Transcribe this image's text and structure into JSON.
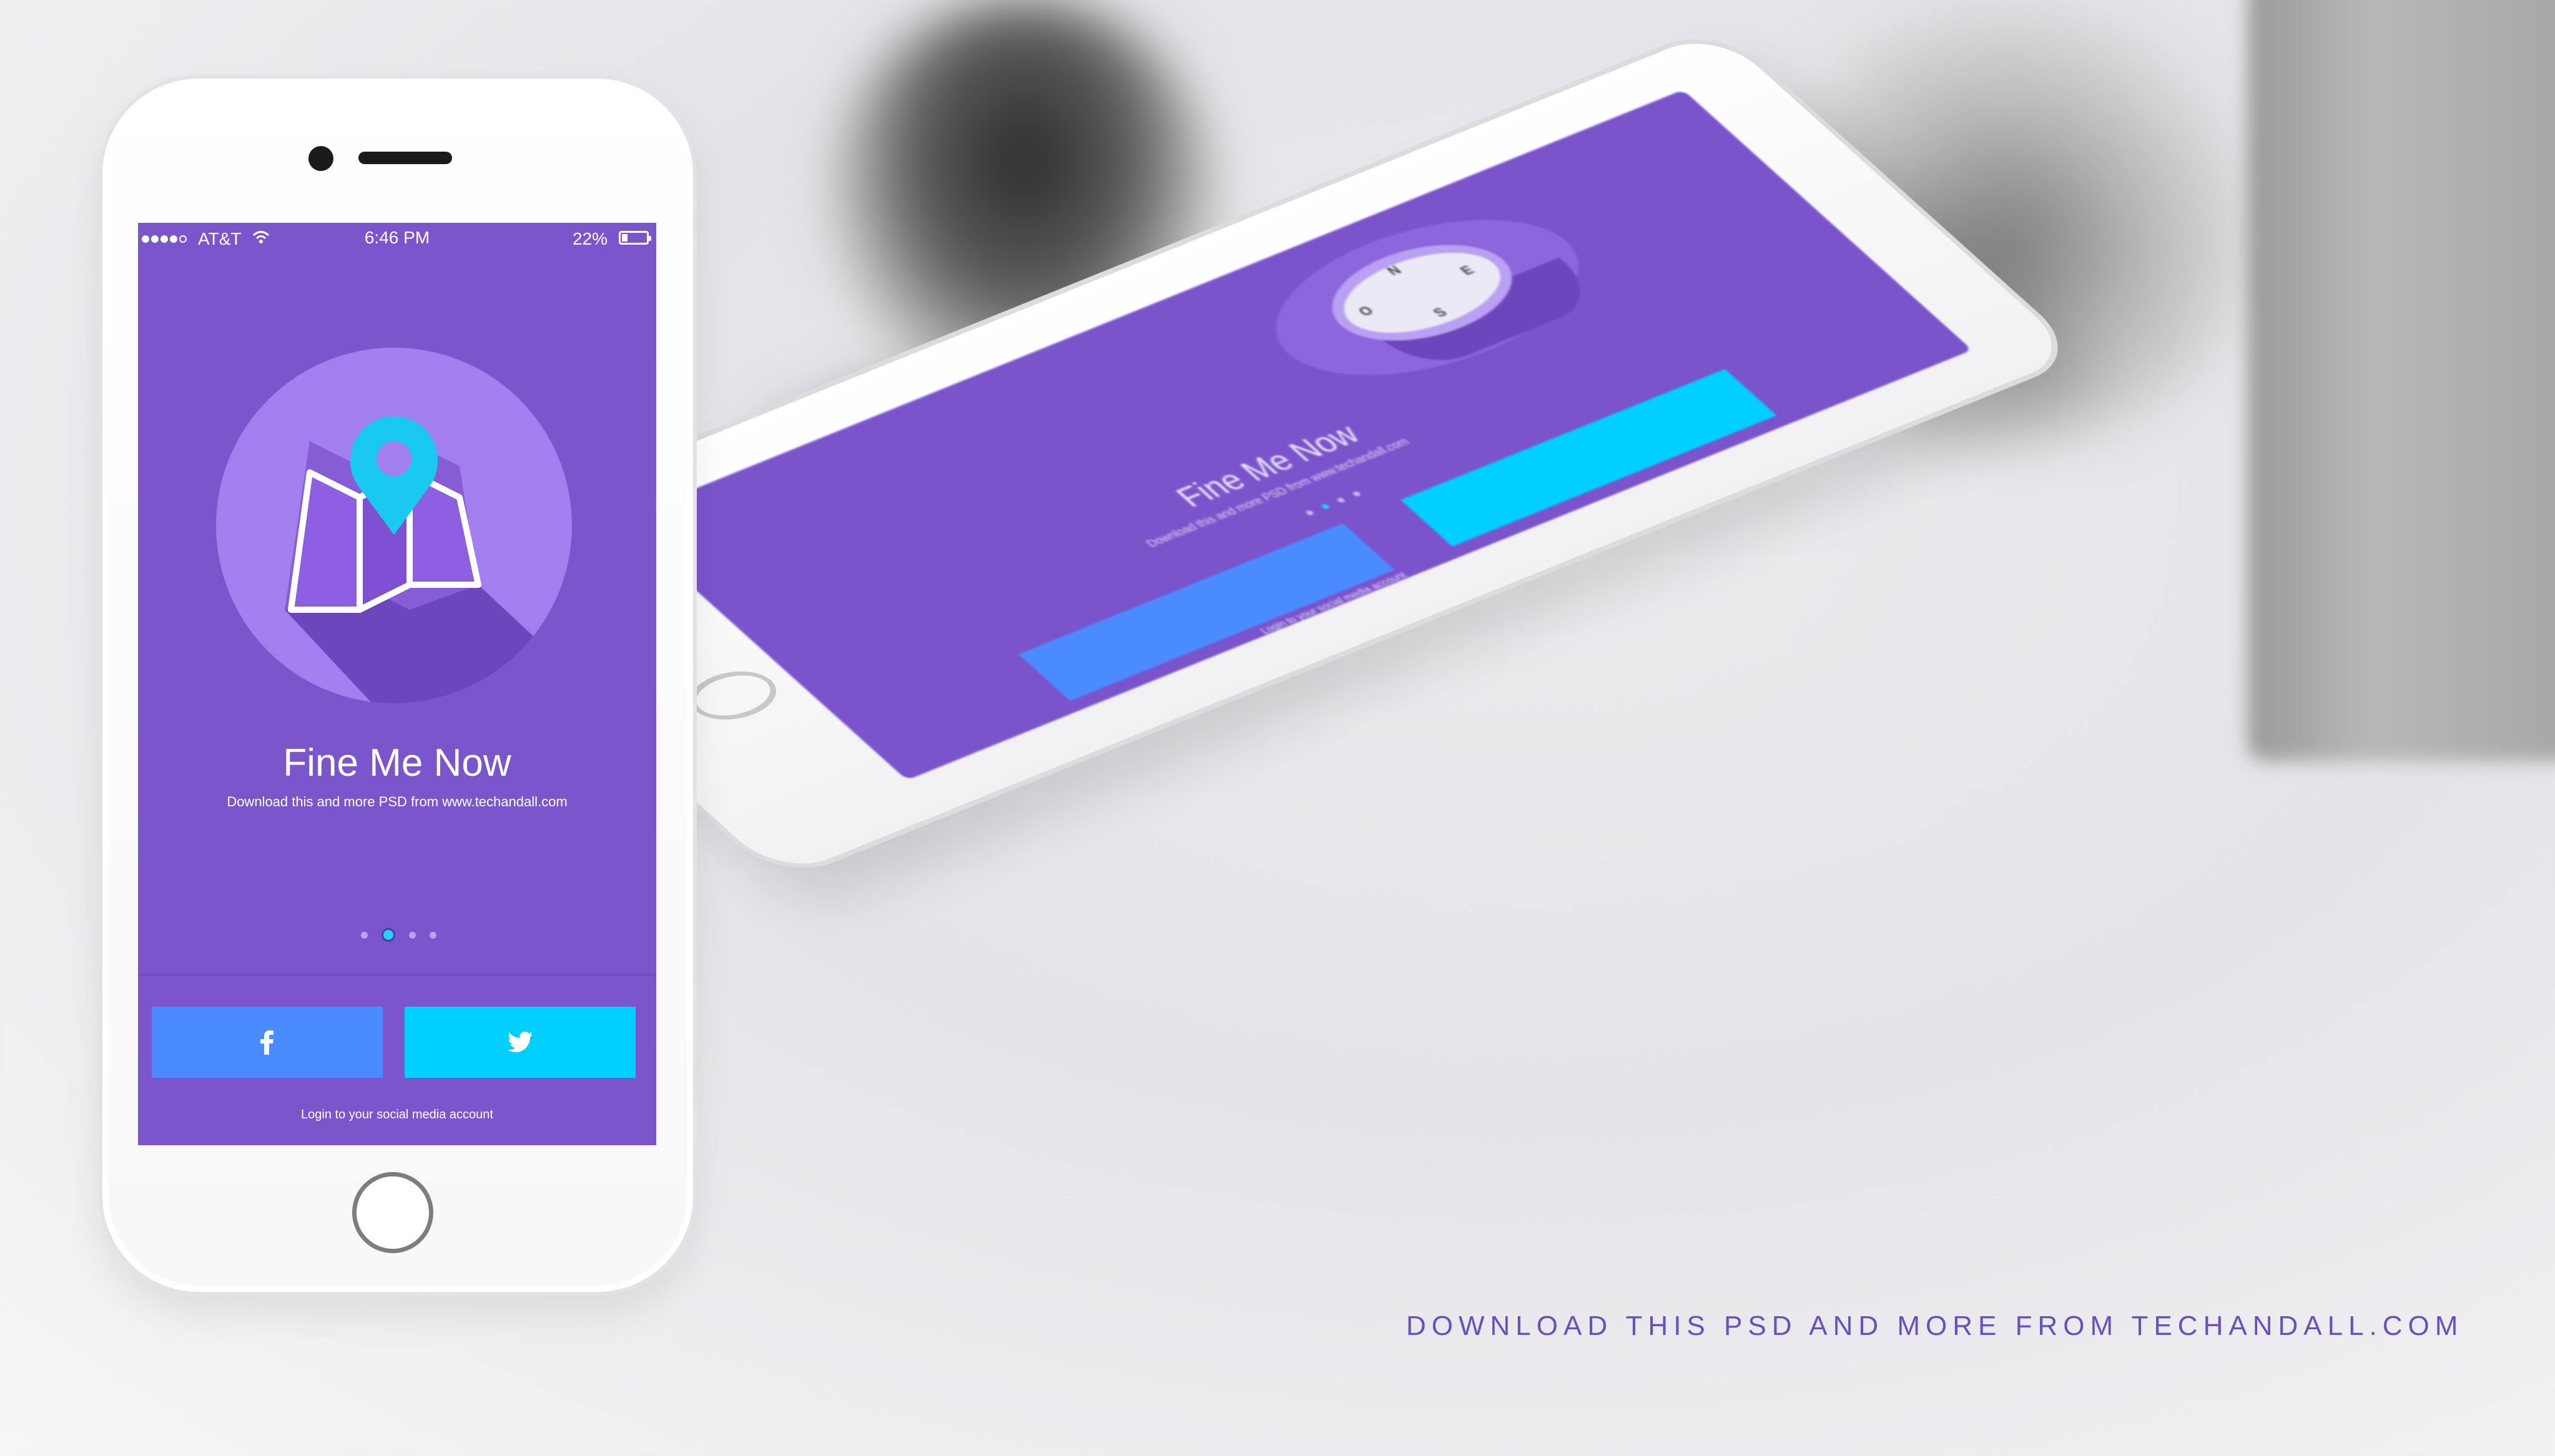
{
  "colors": {
    "screen_bg": "#7a55cc",
    "hero_circle": "#a27eee",
    "pin": "#19c9f0",
    "facebook": "#4a8cff",
    "twitter": "#00cfff",
    "caption": "#6a4fc4"
  },
  "status_bar": {
    "carrier": "AT&T",
    "time": "6:46 PM",
    "battery": "22%"
  },
  "onboarding": {
    "title": "Fine Me Now",
    "subtitle": "Download this and more PSD from www.techandall.com",
    "page_count": 4,
    "active_page": 2,
    "facebook_icon": "facebook-icon",
    "twitter_icon": "twitter-icon",
    "login_text": "Login to your social media account"
  },
  "angled_phone": {
    "title": "Fine Me Now",
    "subtitle": "Download this and more PSD from www.techandall.com",
    "login_text": "Login to your social media account",
    "compass": {
      "n": "N",
      "e": "E",
      "s": "S",
      "w": "O"
    }
  },
  "caption": "DOWNLOAD THIS PSD AND MORE FROM TECHANDALL.COM"
}
